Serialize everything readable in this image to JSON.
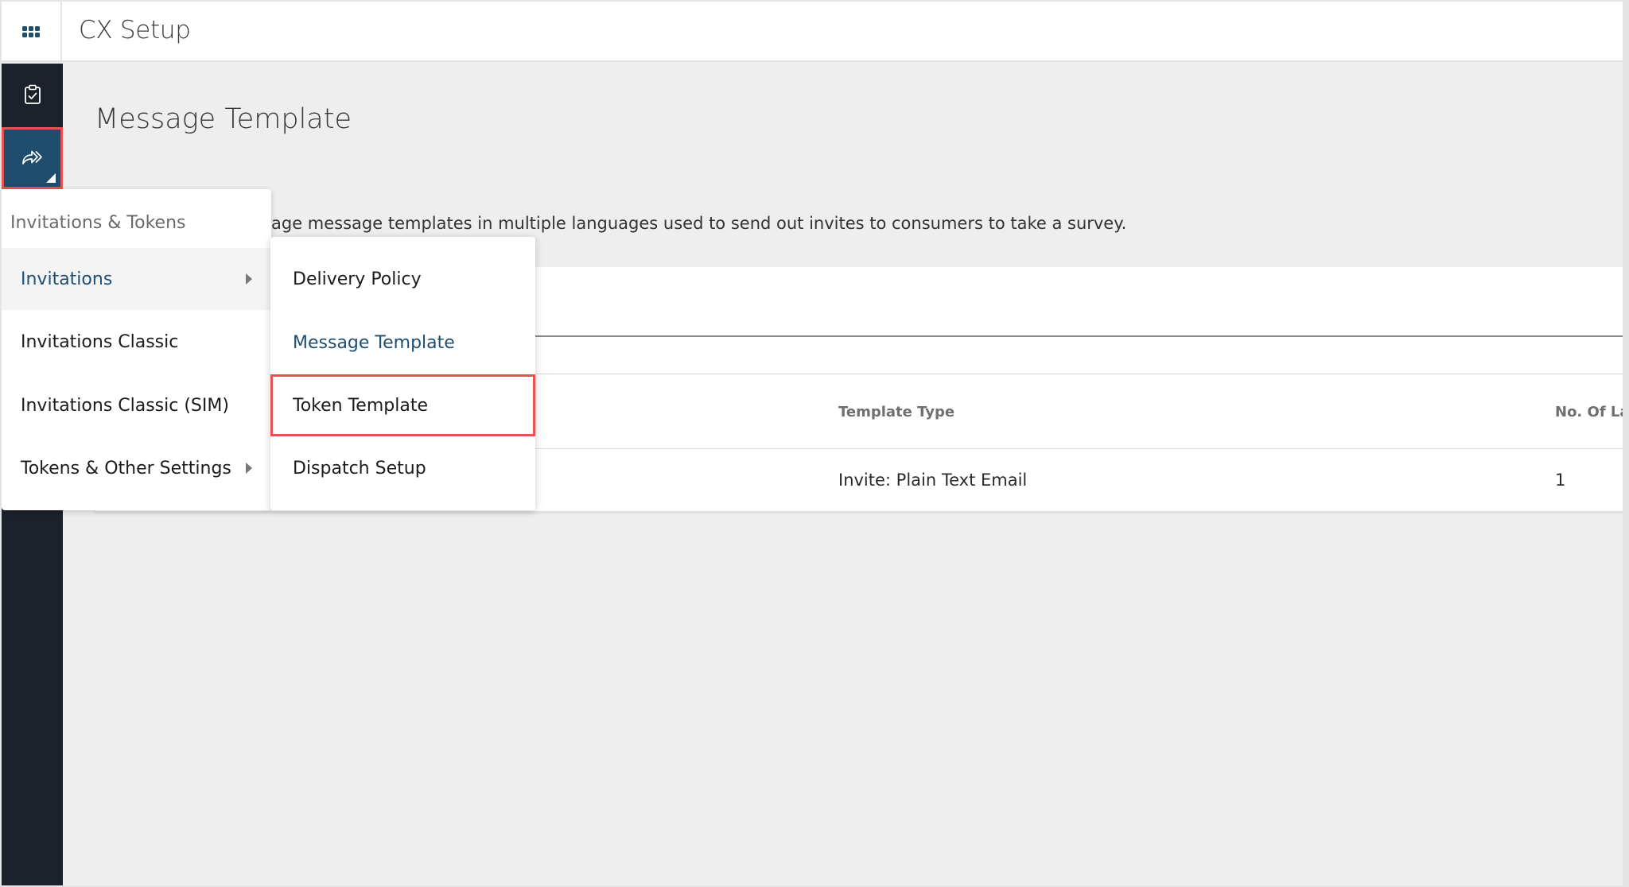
{
  "app": {
    "title": "CX Setup",
    "apps_icon": "apps-grid-icon"
  },
  "sidebar": {
    "items": [
      {
        "icon": "clipboard-check-icon",
        "active": false
      },
      {
        "icon": "share-forward-icon",
        "active": true,
        "highlighted": true
      }
    ]
  },
  "page": {
    "title": "Message Template",
    "description_visible": "age message templates in multiple languages used to send out invites to consumers to take a survey."
  },
  "table": {
    "columns": [
      "Template Type",
      "No. Of La"
    ],
    "rows": [
      {
        "template_type": "Invite: Plain Text Email",
        "no_of_languages": "1"
      }
    ]
  },
  "menu": {
    "header": "Invitations & Tokens",
    "items": [
      {
        "label": "Invitations",
        "has_submenu": true,
        "active": true
      },
      {
        "label": "Invitations Classic",
        "has_submenu": false
      },
      {
        "label": "Invitations Classic (SIM)",
        "has_submenu": false
      },
      {
        "label": "Tokens & Other Settings",
        "has_submenu": true
      }
    ],
    "submenu": {
      "items": [
        {
          "label": "Delivery Policy"
        },
        {
          "label": "Message Template",
          "current": true
        },
        {
          "label": "Token Template",
          "highlighted": true
        },
        {
          "label": "Dispatch Setup"
        }
      ]
    }
  },
  "colors": {
    "brand": "#1f4e73",
    "sidebar_bg": "#1c222b",
    "sidebar_active": "#1e4c6d",
    "highlight_outline": "#e55353",
    "page_bg": "#eeeeee"
  }
}
